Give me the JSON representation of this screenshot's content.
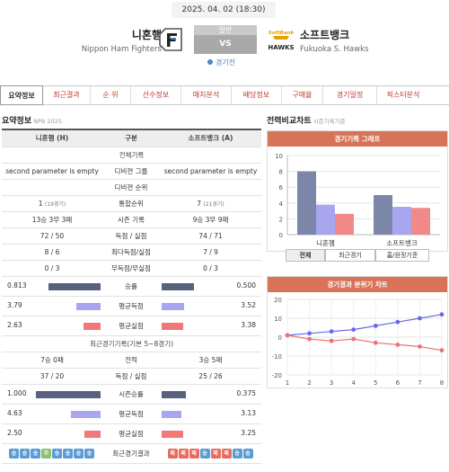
{
  "game": {
    "datetime": "2025. 04. 02 (18:30)",
    "type": "일반",
    "vs": "VS",
    "status": "경기전",
    "home": {
      "name_kr": "니혼햄",
      "name_en": "Nippon Ham Fighters"
    },
    "away": {
      "name_kr": "소프트뱅크",
      "name_en": "Fukuoka S. Hawks",
      "logo_text": "SoftBank HAWKS"
    }
  },
  "tabs": [
    "요약정보",
    "최근결과",
    "순 위",
    "선수정보",
    "매치분석",
    "배당정보",
    "구매율",
    "경기일정",
    "픽스터분석"
  ],
  "summary": {
    "title": "요약정보",
    "subtitle": "NPB 2025",
    "headers": [
      "니혼햄 (H)",
      "구분",
      "소프트뱅크 (A)"
    ],
    "section1": "전체기록",
    "rows": [
      {
        "home": "second parameter is empty",
        "label": "디비젼 그룹",
        "away": "second parameter is empty"
      },
      {
        "home": "",
        "label": "디비젼 순위",
        "away": ""
      },
      {
        "home": "1",
        "home_note": "(19경기)",
        "label": "통합순위",
        "away": "7",
        "away_note": "(21경기)"
      },
      {
        "home": "13승 3무 3패",
        "label": "시즌 기록",
        "away": "9승 3무 9패"
      },
      {
        "home": "72 / 50",
        "label": "득점 / 실점",
        "away": "74 / 71"
      },
      {
        "home": "8 / 6",
        "label": "최다득점/실점",
        "away": "7 / 9"
      },
      {
        "home": "0 / 3",
        "label": "무득점/무실점",
        "away": "0 / 3"
      }
    ],
    "bars1": [
      {
        "label": "승률",
        "home": "0.813",
        "away": "0.500",
        "home_pct": 0.81,
        "away_pct": 0.5
      },
      {
        "label": "평균득점",
        "home": "3.79",
        "away": "3.52",
        "home_pct": 0.38,
        "away_pct": 0.35
      },
      {
        "label": "평균실점",
        "home": "2.63",
        "away": "3.38",
        "home_pct": 0.26,
        "away_pct": 0.34
      }
    ],
    "section2": "최근경기기록(기본 5~8경기)",
    "rows2": [
      {
        "home": "7승 0패",
        "label": "전적",
        "away": "3승 5패"
      },
      {
        "home": "37 / 20",
        "label": "득점 / 실점",
        "away": "25 / 26"
      }
    ],
    "bars2": [
      {
        "label": "시즌승률",
        "home": "1.000",
        "away": "0.375",
        "home_pct": 1.0,
        "away_pct": 0.375
      },
      {
        "label": "평균득점",
        "home": "4.63",
        "away": "3.13",
        "home_pct": 0.46,
        "away_pct": 0.31
      },
      {
        "label": "평균실점",
        "home": "2.50",
        "away": "3.25",
        "home_pct": 0.25,
        "away_pct": 0.33
      }
    ],
    "recent_label": "최근경기결과",
    "home_recent": [
      "승",
      "승",
      "승",
      "무",
      "승",
      "승",
      "승",
      "승"
    ],
    "away_recent": [
      "패",
      "패",
      "패",
      "승",
      "패",
      "패",
      "승",
      "승"
    ]
  },
  "compare": {
    "title": "전력비교차트",
    "subtitle": "시즌기록기준",
    "colors": {
      "accent": "#d97358",
      "win": "#7b86a8",
      "mid": "#a9a6f0",
      "loss": "#f28989",
      "blue_line": "#6a6ae8",
      "red_line": "#ea7474"
    },
    "buttons": [
      "전체",
      "최근경기",
      "홈/원정기준"
    ],
    "active_button": "전체"
  },
  "chart_data": [
    {
      "type": "bar",
      "title": "경기기록 그래프",
      "categories": [
        "니혼햄",
        "소프트뱅크"
      ],
      "series": [
        {
          "values": [
            8,
            5
          ]
        },
        {
          "values": [
            3.79,
            3.52
          ]
        },
        {
          "values": [
            2.63,
            3.38
          ]
        }
      ],
      "ylim": [
        0,
        10
      ],
      "yticks": [
        0,
        2,
        4,
        6,
        8,
        10
      ],
      "grid": true
    },
    {
      "type": "line",
      "title": "경기결과 분위기 차트",
      "x": [
        1,
        2,
        3,
        4,
        5,
        6,
        7,
        8
      ],
      "series": [
        {
          "values": [
            1,
            2,
            3,
            4,
            6,
            8,
            10,
            12
          ]
        },
        {
          "values": [
            1,
            -1,
            -2,
            -1,
            -3,
            -4,
            -5,
            -7
          ]
        }
      ],
      "ylim": [
        -20,
        20
      ],
      "yticks": [
        20,
        10,
        0,
        -10,
        -20
      ],
      "grid": true
    }
  ]
}
